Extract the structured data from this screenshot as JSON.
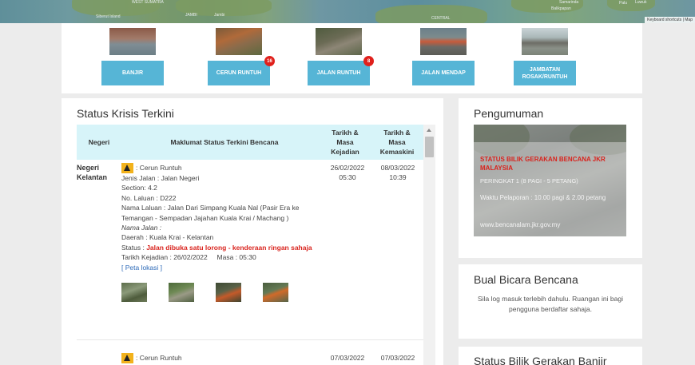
{
  "map": {
    "labels": [
      "WEST SUMATRA",
      "Siberut Island",
      "JAMBI",
      "Jambi",
      "CENTRAL",
      "Samarinda",
      "Balikpapan",
      "Luwuk",
      "Palu"
    ],
    "attribution": "Keyboard shortcuts | Map"
  },
  "categories": [
    {
      "label": "BANJIR",
      "badge": ""
    },
    {
      "label": "CERUN RUNTUH",
      "badge": "16"
    },
    {
      "label": "JALAN RUNTUH",
      "badge": "8"
    },
    {
      "label": "JALAN MENDAP",
      "badge": ""
    },
    {
      "label": "JAMBATAN ROSAK/RUNTUH",
      "badge": ""
    }
  ],
  "status": {
    "title": "Status Krisis Terkini",
    "headers": {
      "negeri": "Negeri",
      "maklumat": "Maklumat Status Terkini Bencana",
      "kejadian": "Tarikh & Masa Kejadian",
      "kemaskini": "Tarikh & Masa Kemaskini"
    },
    "rows": [
      {
        "negeri": "Negeri Kelantan",
        "type": ": Cerun Runtuh",
        "jenis_jalan": "Jenis Jalan : Jalan Negeri",
        "section": "Section: 4.2",
        "no_laluan": "No. Laluan : D222",
        "nama_laluan": "Nama Laluan : Jalan Dari Simpang Kuala Nal (Pasir Era ke Temangan - Sempadan Jajahan Kuala Krai / Machang )",
        "nama_jalan": "Nama Jalan :",
        "daerah": "Daerah : Kuala Krai - Kelantan",
        "status_label": "Status :",
        "status_value": "Jalan dibuka satu lorong - kenderaan ringan sahaja",
        "tarikh": "Tarikh Kejadian : 26/02/2022     Masa : 05:30",
        "peta": "[ Peta lokasi ]",
        "kejadian_date": "26/02/2022",
        "kejadian_time": "05:30",
        "kemaskini_date": "08/03/2022",
        "kemaskini_time": "10:39"
      },
      {
        "negeri": "",
        "type": ": Cerun Runtuh",
        "kejadian_date": "07/03/2022",
        "kemaskini_date": "07/03/2022"
      }
    ]
  },
  "pengumuman": {
    "title": "Pengumuman",
    "heading": "STATUS BILIK GERAKAN BENCANA JKR MALAYSIA",
    "level": "PERINGKAT 1 (8 PAGI - 5 PETANG)",
    "waktu": "Waktu Pelaporan : 10.00 pagi & 2.00 petang",
    "url": "www.bencanalam.jkr.gov.my"
  },
  "bual": {
    "title": "Bual Bicara Bencana",
    "text": "Sila log masuk terlebih dahulu. Ruangan ini bagi pengguna berdaftar sahaja."
  },
  "banjir": {
    "title": "Status Bilik Gerakan Banjir"
  }
}
